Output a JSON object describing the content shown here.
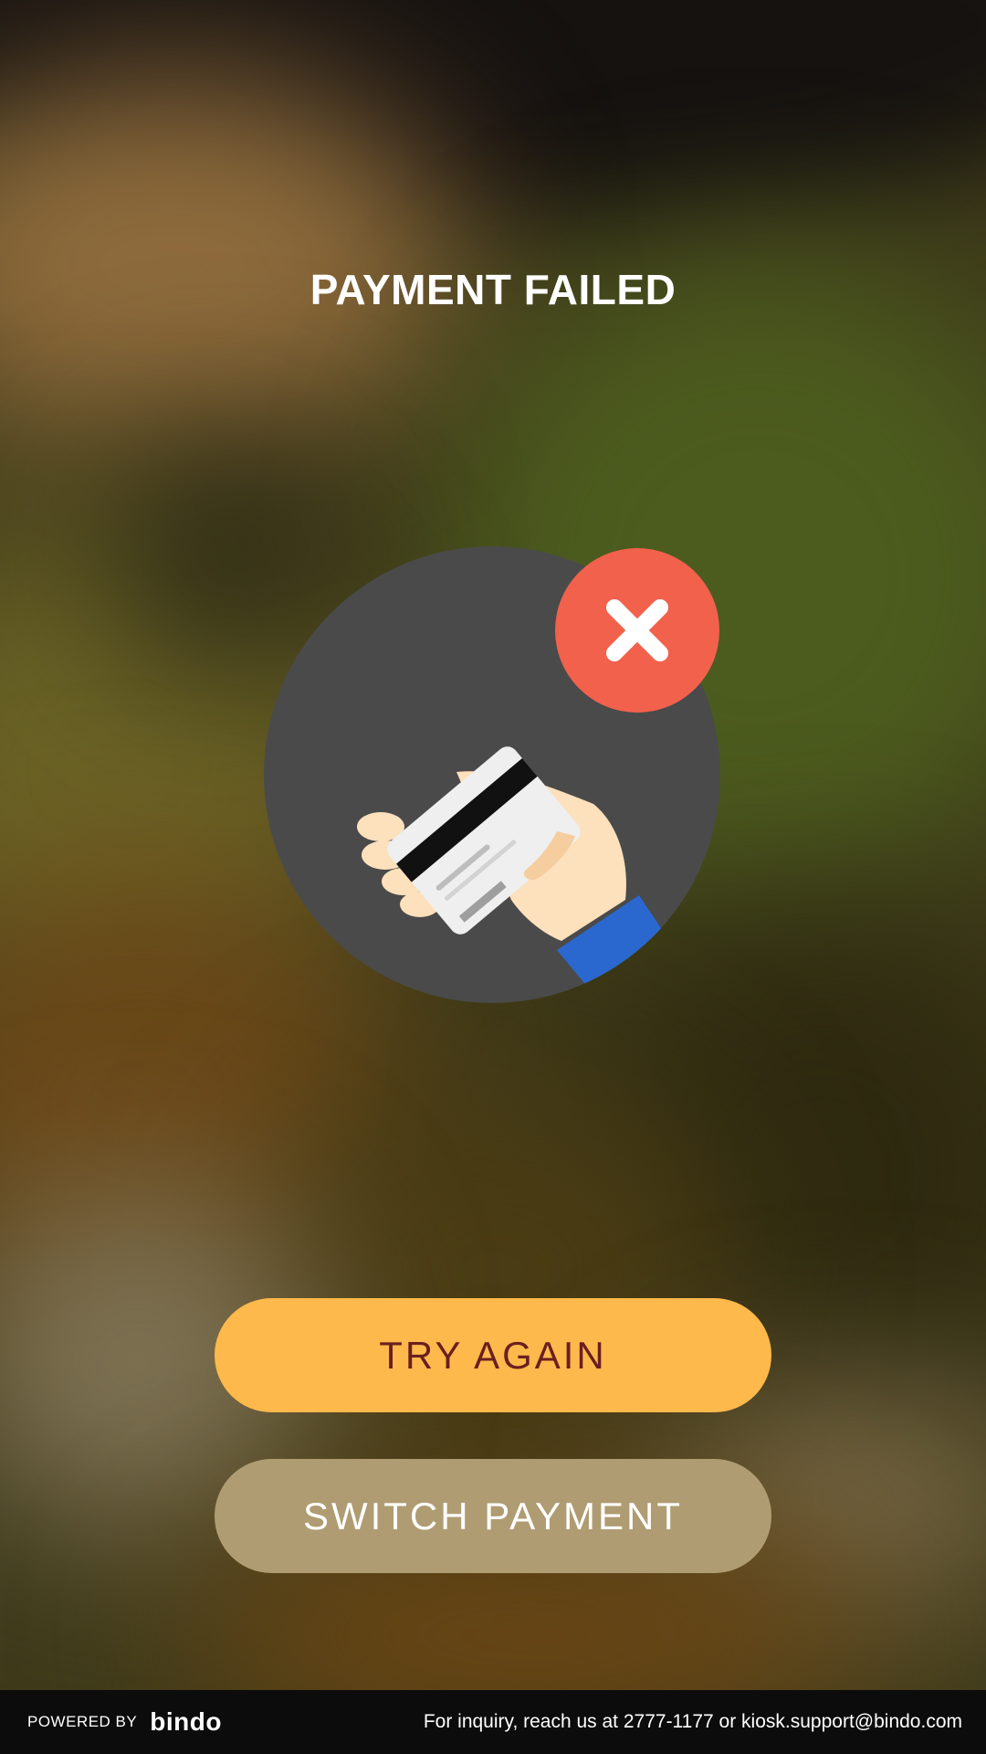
{
  "screen": {
    "title": "PAYMENT FAILED",
    "illustration_icon": "card-declined-icon",
    "status_icon": "close-icon"
  },
  "actions": {
    "try_again_label": "TRY AGAIN",
    "switch_payment_label": "SWITCH PAYMENT"
  },
  "footer": {
    "powered_by_label": "POWERED BY",
    "brand_name": "bindo",
    "inquiry_text": "For inquiry, reach us at 2777-1177 or  kiosk.support@bindo.com"
  },
  "colors": {
    "primary_button": "#fdb94b",
    "primary_button_text": "#6b1f1f",
    "secondary_button": "#b09c72",
    "error": "#f2614c",
    "footer_background": "#0c0c0c"
  }
}
